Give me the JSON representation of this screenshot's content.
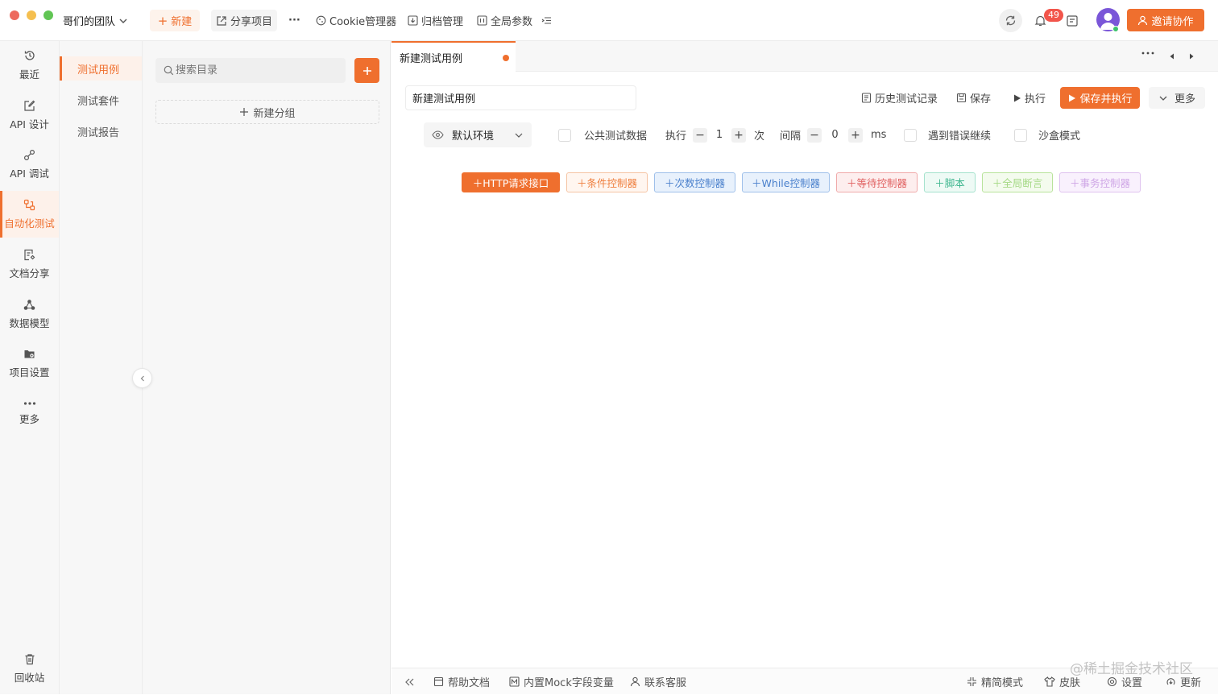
{
  "window": {
    "team_name": "哥们的团队"
  },
  "toolbar": {
    "new_label": "新建",
    "share_label": "分享项目",
    "more_label": "···",
    "cookie_label": "Cookie管理器",
    "archive_label": "归档管理",
    "params_label": "全局参数",
    "notification_count": "49",
    "invite_label": "邀请协作"
  },
  "left_nav": {
    "items": [
      {
        "label": "最近",
        "icon": "clock-icon"
      },
      {
        "label": "API 设计",
        "icon": "edit-icon"
      },
      {
        "label": "API 调试",
        "icon": "debug-icon"
      },
      {
        "label": "自动化测试",
        "icon": "flow-icon"
      },
      {
        "label": "文档分享",
        "icon": "doc-share-icon"
      },
      {
        "label": "数据模型",
        "icon": "model-icon"
      },
      {
        "label": "项目设置",
        "icon": "folder-gear-icon"
      },
      {
        "label": "更多",
        "icon": "more-icon"
      }
    ],
    "trash_label": "回收站",
    "active": "自动化测试"
  },
  "sub_nav": {
    "items": [
      "测试用例",
      "测试套件",
      "测试报告"
    ],
    "active": "测试用例"
  },
  "tree": {
    "search_placeholder": "搜索目录",
    "new_group_label": "新建分组"
  },
  "tab": {
    "title": "新建测试用例"
  },
  "editor": {
    "name_value": "新建测试用例",
    "history_label": "历史测试记录",
    "save_label": "保存",
    "run_label": "执行",
    "save_run_label": "保存并执行",
    "more_label": "更多",
    "env_label": "默认环境",
    "public_data_label": "公共测试数据",
    "run_count_label": "执行",
    "run_count_value": "1",
    "run_count_unit": "次",
    "interval_label": "间隔",
    "interval_value": "0",
    "interval_unit": "ms",
    "continue_on_error_label": "遇到错误继续",
    "sandbox_label": "沙盒模式"
  },
  "controllers": [
    {
      "label": "HTTP请求接口",
      "style": "solid"
    },
    {
      "label": "条件控制器"
    },
    {
      "label": "次数控制器"
    },
    {
      "label": "While控制器"
    },
    {
      "label": "等待控制器"
    },
    {
      "label": "脚本"
    },
    {
      "label": "全局断言"
    },
    {
      "label": "事务控制器"
    }
  ],
  "bottom_bar": {
    "help_label": "帮助文档",
    "mock_label": "内置Mock字段变量",
    "support_label": "联系客服",
    "compact_label": "精简模式",
    "skin_label": "皮肤",
    "settings_label": "设置",
    "update_label": "更新",
    "watermark": "@稀土掘金技术社区"
  },
  "colors": {
    "accent": "#ef6f2e",
    "http": "#ef6f2e",
    "condition": "#f0a06a",
    "count": "#5b8fd9",
    "while": "#5b8fd9",
    "wait": "#e57373",
    "script": "#5cc9a7",
    "assert": "#8fd16a",
    "transaction": "#c99be0"
  }
}
